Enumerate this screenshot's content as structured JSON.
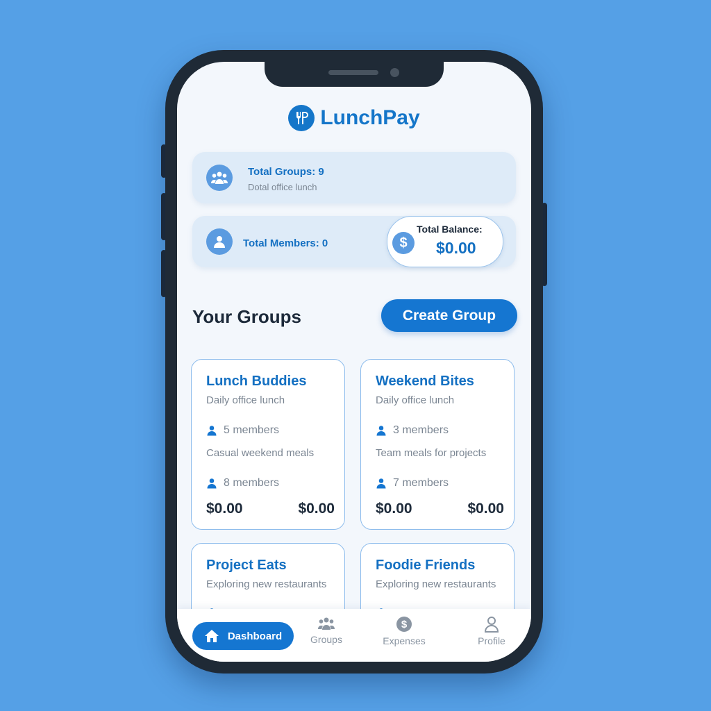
{
  "app": {
    "name": "LunchPay"
  },
  "stats": {
    "groups": {
      "title": "Total Groups: 9",
      "subtitle": "Dotal office lunch"
    },
    "members": {
      "title": "Total Members: 0"
    },
    "balance": {
      "label": "Total Balance:",
      "value": "$0.00"
    }
  },
  "groups_section": {
    "title": "Your Groups",
    "create_label": "Create Group"
  },
  "groups": [
    {
      "name": "Lunch Buddies",
      "description": "Daily office lunch",
      "members": "5 members",
      "extra_description": "Casual weekend meals",
      "extra_members": "8 members",
      "amount_left": "$0.00",
      "amount_right": "$0.00"
    },
    {
      "name": "Weekend Bites",
      "description": "Daily office lunch",
      "members": "3 members",
      "extra_description": "Team meals for projects",
      "extra_members": "7 members",
      "amount_left": "$0.00",
      "amount_right": "$0.00"
    },
    {
      "name": "Project Eats",
      "description": "Exploring new restaurants"
    },
    {
      "name": "Foodie Friends",
      "description": "Exploring new restaurants"
    }
  ],
  "nav": {
    "dashboard": "Dashboard",
    "groups": "Groups",
    "expenses": "Expenses",
    "profile": "Profile"
  },
  "colors": {
    "primary": "#1576d1",
    "background": "#55a0e6",
    "card": "#deebf8"
  },
  "icons": [
    "fork-logo-icon",
    "groups-icon",
    "user-icon",
    "dollar-icon",
    "home-icon",
    "profile-icon"
  ]
}
